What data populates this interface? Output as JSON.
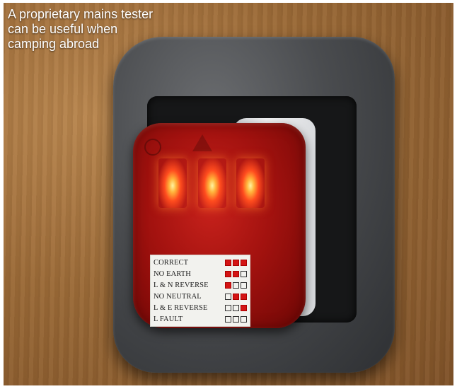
{
  "caption": {
    "lines": [
      "A proprietary mains tester",
      "can be useful when",
      "camping abroad"
    ]
  },
  "tester": {
    "legend": [
      {
        "label": "CORRECT",
        "lamps": [
          true,
          true,
          true
        ]
      },
      {
        "label": "NO EARTH",
        "lamps": [
          true,
          true,
          false
        ]
      },
      {
        "label": "L & N REVERSE",
        "lamps": [
          true,
          false,
          false
        ]
      },
      {
        "label": "NO NEUTRAL",
        "lamps": [
          false,
          true,
          true
        ]
      },
      {
        "label": "L & E REVERSE",
        "lamps": [
          false,
          false,
          true
        ]
      },
      {
        "label": "L  FAULT",
        "lamps": [
          false,
          false,
          false
        ]
      }
    ],
    "colors": {
      "lamp_on": "#d41414",
      "housing": "#a3120f"
    }
  }
}
